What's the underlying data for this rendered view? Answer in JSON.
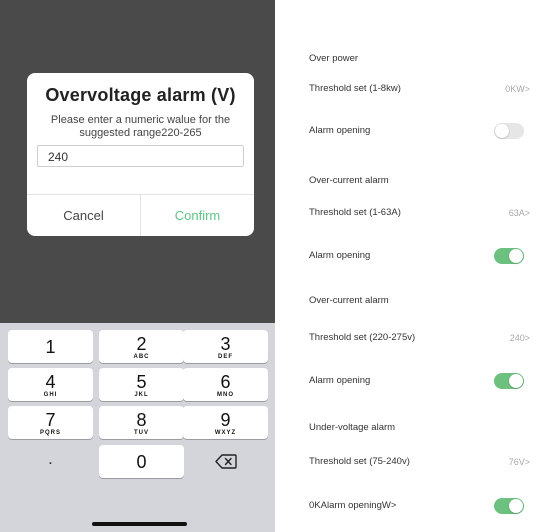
{
  "dialog": {
    "title": "Overvoltage alarm (V)",
    "message": "Please enter a numeric walue for the suggested range220-265",
    "input_value": "240",
    "cancel_label": "Cancel",
    "confirm_label": "Confirm"
  },
  "keyboard": {
    "keys": [
      {
        "num": "1",
        "letters": ""
      },
      {
        "num": "2",
        "letters": "ABC"
      },
      {
        "num": "3",
        "letters": "DEF"
      },
      {
        "num": "4",
        "letters": "GHI"
      },
      {
        "num": "5",
        "letters": "JKL"
      },
      {
        "num": "6",
        "letters": "MNO"
      },
      {
        "num": "7",
        "letters": "PQRS"
      },
      {
        "num": "8",
        "letters": "TUV"
      },
      {
        "num": "9",
        "letters": "WXYZ"
      },
      {
        "num": "0",
        "letters": ""
      }
    ],
    "dot_label": ".",
    "backspace_icon": "backspace-icon"
  },
  "settings": {
    "rows": [
      {
        "label": "Over power"
      },
      {
        "label": "Threshold set (1-8kw)",
        "value": "0KW>"
      },
      {
        "label": "Alarm opening",
        "toggle": false
      },
      {
        "label": "Over-current alarm"
      },
      {
        "label": "Threshold set (1-63A)",
        "value": "63A>"
      },
      {
        "label": "Alarm opening",
        "toggle": true
      },
      {
        "label": "Over-current alarm"
      },
      {
        "label": "Threshold set (220-275v)",
        "value": "240>"
      },
      {
        "label": "Alarm opening",
        "toggle": true
      },
      {
        "label": "Under-voltage alarm"
      },
      {
        "label": "Threshold set (75-240v)",
        "value": "76V>"
      },
      {
        "label": "0KAlarm openingW>",
        "toggle": true
      }
    ]
  },
  "colors": {
    "accent": "#6cc17f",
    "confirm_text": "#5ec487",
    "overlay": "#4a4a4a",
    "keyboard_bg": "#d4d5da"
  }
}
